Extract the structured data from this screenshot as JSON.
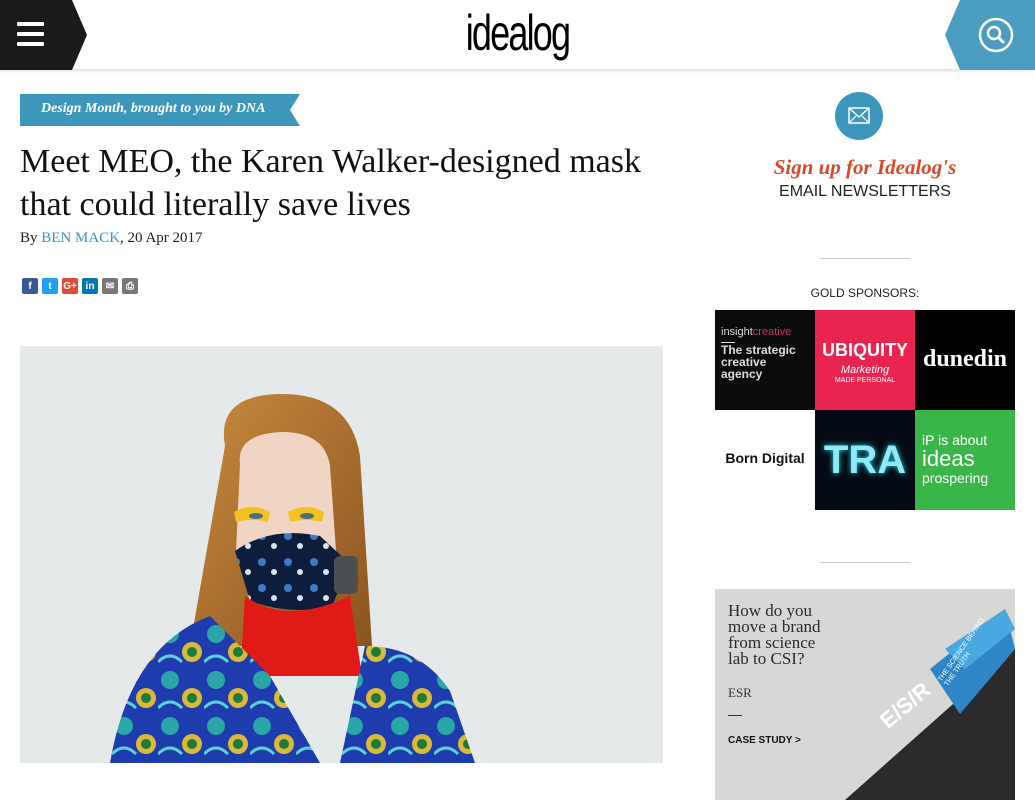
{
  "header": {
    "logo": "idealog",
    "menu_icon": "hamburger-menu-icon",
    "search_icon": "search-icon"
  },
  "article": {
    "category": "Design Month, brought to you by DNA",
    "title": "Meet MEO, the Karen Walker-designed mask that could literally save lives",
    "byline_prefix": "By ",
    "author": "BEN MACK",
    "date": ", 20 Apr 2017",
    "share": [
      {
        "name": "facebook",
        "glyph": "f",
        "color": "#3b5998"
      },
      {
        "name": "twitter",
        "glyph": "t",
        "color": "#1da1f2"
      },
      {
        "name": "google-plus",
        "glyph": "G+",
        "color": "#dd4b39"
      },
      {
        "name": "linkedin",
        "glyph": "in",
        "color": "#0077b5"
      },
      {
        "name": "email",
        "glyph": "✉",
        "color": "#777777"
      },
      {
        "name": "print",
        "glyph": "⎙",
        "color": "#777777"
      }
    ]
  },
  "sidebar": {
    "newsletter_signup": "Sign up for Idealog's",
    "newsletter_sub": "EMAIL NEWSLETTERS",
    "sponsors_label": "GOLD SPONSORS:",
    "sponsors": {
      "insight": {
        "brand_a": "insight",
        "brand_b": "creative",
        "tagline": "The strategic creative agency"
      },
      "ubiquity": {
        "name": "UBIQUITY",
        "sub": "Marketing",
        "tag": "MADE PERSONAL"
      },
      "dunedin": {
        "name": "dunedin"
      },
      "born_digital": {
        "name": "Born Digital"
      },
      "tra": {
        "name": "TRA"
      },
      "ip": {
        "lead": "iP is about",
        "big": "ideas",
        "tail": "prospering"
      }
    },
    "ad": {
      "question": "How do you\nmove a brand\nfrom science\nlab to CSI?",
      "brand": "ESR",
      "cta": "CASE STUDY >",
      "logo": "E/S/R",
      "tag": "THE SCIENCE BEHIND THE TRUTH"
    }
  },
  "colors": {
    "accent": "#3c97bb",
    "signup_red": "#d64a2c",
    "header_dark": "#1a1a1a"
  }
}
